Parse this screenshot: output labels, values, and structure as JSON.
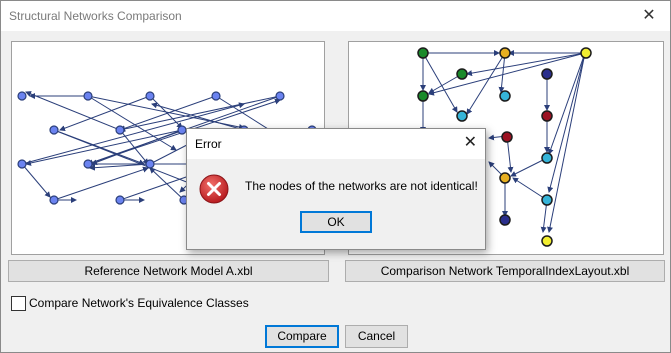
{
  "window": {
    "title": "Structural Networks Comparison"
  },
  "left_panel": {
    "file_label": "Reference Network Model A.xbl"
  },
  "right_panel": {
    "file_label": "Comparison Network TemporalIndexLayout.xbl"
  },
  "options": {
    "equivalence_label": "Compare Network's Equivalence Classes",
    "equivalence_checked": false
  },
  "buttons": {
    "compare": "Compare",
    "cancel": "Cancel"
  },
  "dialog": {
    "title": "Error",
    "message": "The nodes of the networks are not identical!",
    "ok": "OK",
    "icon": "error-icon"
  },
  "colors": {
    "node_blue": "#6b83f0",
    "node_green": "#1a8a2a",
    "node_gold": "#e8b020",
    "node_yellow": "#f2ee30",
    "node_cyan": "#36b4d8",
    "node_navy": "#2a2e8c",
    "node_red": "#9c1222",
    "edge": "#2b3f7a",
    "error_red": "#d0282a"
  }
}
